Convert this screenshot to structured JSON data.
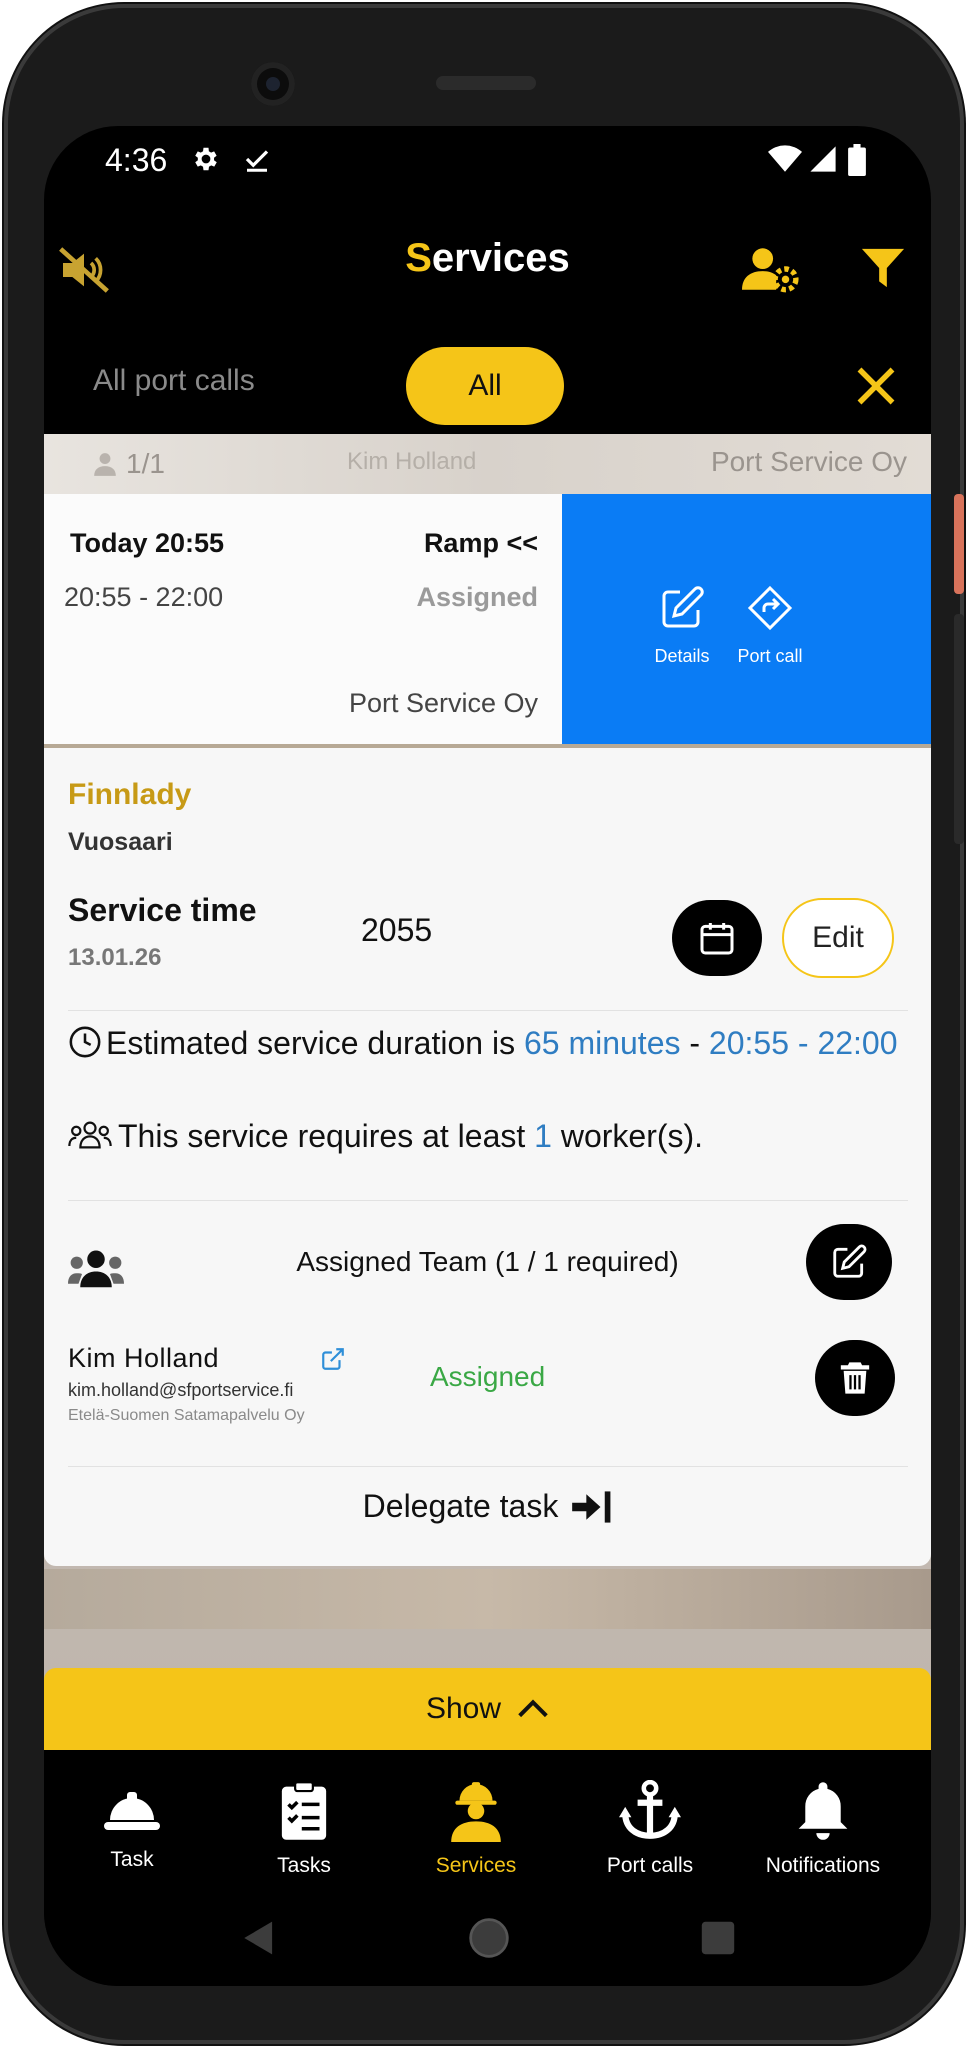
{
  "status_bar": {
    "time": "4:36"
  },
  "header": {
    "title_first": "S",
    "title_rest": "ervices"
  },
  "tabs": {
    "all_port_calls": "All port calls",
    "all": "All"
  },
  "peek_row": {
    "count": "1/1",
    "worker": "Kim Holland",
    "company": "Port Service Oy"
  },
  "service_card": {
    "date": "Today 20:55",
    "ramp": "Ramp <<",
    "time_range": "20:55 - 22:00",
    "status": "Assigned",
    "company": "Port Service Oy",
    "actions": {
      "details": "Details",
      "port_call": "Port call"
    }
  },
  "detail": {
    "vessel": "Finnlady",
    "port": "Vuosaari",
    "service_time_label": "Service time",
    "service_date": "13.01.26",
    "service_time_value": "2055",
    "edit_label": "Edit",
    "estimate_prefix": "Estimated service duration is ",
    "estimate_minutes": "65 minutes",
    "estimate_sep": " - ",
    "estimate_range": "20:55 - 22:00",
    "requires_prefix": "This service requires at least ",
    "requires_count": "1",
    "requires_suffix": " worker(s).",
    "team_label": "Assigned Team (1 / 1 required)",
    "worker": {
      "name": "Kim Holland",
      "email": "kim.holland@sfportservice.fi",
      "org": "Etelä-Suomen Satamapalvelu Oy",
      "status": "Assigned"
    },
    "delegate_label": "Delegate task"
  },
  "show_bar": {
    "label": "Show"
  },
  "bottom_nav": {
    "items": [
      {
        "label": "Task",
        "icon": "hard-hat-icon"
      },
      {
        "label": "Tasks",
        "icon": "clipboard-list-icon"
      },
      {
        "label": "Services",
        "icon": "worker-icon"
      },
      {
        "label": "Port calls",
        "icon": "anchor-icon"
      },
      {
        "label": "Notifications",
        "icon": "bell-icon"
      }
    ],
    "active": "Services"
  },
  "colors": {
    "accent": "#f5c518",
    "action_blue": "#0a7cf5",
    "link_blue": "#2f7dc2",
    "assigned_green": "#3aa845",
    "vessel_gold": "#c79a16"
  }
}
